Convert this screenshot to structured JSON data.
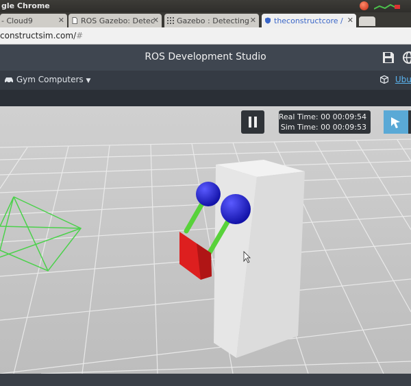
{
  "browser": {
    "window_title": "gle Chrome",
    "tabs": [
      {
        "label": "- Cloud9",
        "icon": "cloud9-icon"
      },
      {
        "label": "ROS Gazebo: Detec",
        "icon": "page-icon"
      },
      {
        "label": "Gazebo : Detecting",
        "icon": "grid-icon"
      },
      {
        "label": "theconstructcore /",
        "icon": "shield-icon"
      }
    ],
    "url": "constructsim.com/",
    "url_suffix": "#"
  },
  "app": {
    "title": "ROS Development Studio",
    "menu_label": "Gym Computers",
    "right_label": "Ubu"
  },
  "sim": {
    "real_time": "Real Time: 00 00:09:54",
    "sim_time": "Sim Time: 00 00:09:53"
  },
  "colors": {
    "header_bg": "#3f4650",
    "link_blue": "#1a7fc1",
    "select_blue": "#5aa9d6",
    "robot_red": "#dd1f1f",
    "robot_green": "#58d23a",
    "robot_blue": "#2222cc"
  }
}
